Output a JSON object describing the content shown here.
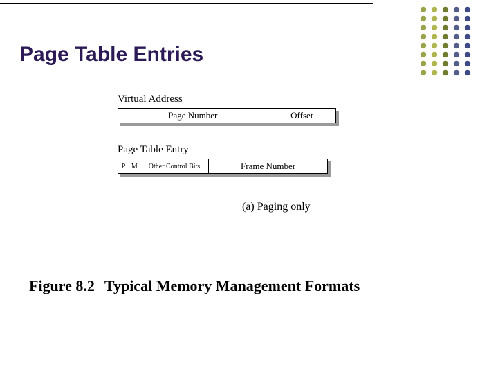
{
  "title": "Page Table Entries",
  "virtual_address": {
    "heading": "Virtual Address",
    "page_number": "Page Number",
    "offset": "Offset"
  },
  "page_table_entry": {
    "heading": "Page Table Entry",
    "p": "P",
    "m": "M",
    "other_control_bits": "Other Control Bits",
    "frame_number": "Frame Number"
  },
  "subcaption": "(a) Paging only",
  "figure": {
    "number": "Figure 8.2",
    "title": "Typical Memory Management Formats"
  },
  "decor": {
    "dot_colors": [
      "#9aa34a",
      "#b0b64f",
      "#6e7d2f",
      "#545e8b",
      "#3d4a85"
    ]
  }
}
